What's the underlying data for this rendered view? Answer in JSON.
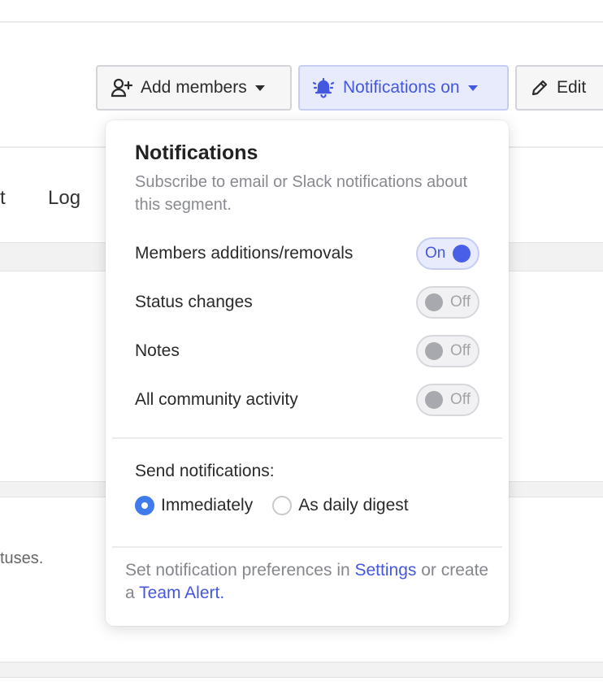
{
  "toolbar": {
    "add_members_label": "Add members",
    "notifications_label": "Notifications on",
    "edit_label": "Edit"
  },
  "background": {
    "tab_partial": "t",
    "tab_log": "Log",
    "partial_text": "tuses."
  },
  "popover": {
    "title": "Notifications",
    "subtitle": "Subscribe to email or Slack notifications about this segment.",
    "rows": [
      {
        "label": "Members additions/removals",
        "state": "On"
      },
      {
        "label": "Status changes",
        "state": "Off"
      },
      {
        "label": "Notes",
        "state": "Off"
      },
      {
        "label": "All community activity",
        "state": "Off"
      }
    ],
    "send_label": "Send notifications:",
    "options": [
      {
        "label": "Immediately",
        "checked": true
      },
      {
        "label": "As daily digest",
        "checked": false
      }
    ],
    "footer": {
      "prefix": "Set notification preferences in ",
      "settings_link": "Settings",
      "middle": " or create a ",
      "team_alert_link": "Team Alert",
      "suffix": "."
    }
  },
  "colors": {
    "accent": "#4458df",
    "toggle_on": "#4a5fe8",
    "radio_checked": "#3f7bea"
  },
  "icons": {
    "add_members": "user-plus-icon",
    "notifications": "bell-ringing-icon",
    "edit": "pencil-icon"
  }
}
